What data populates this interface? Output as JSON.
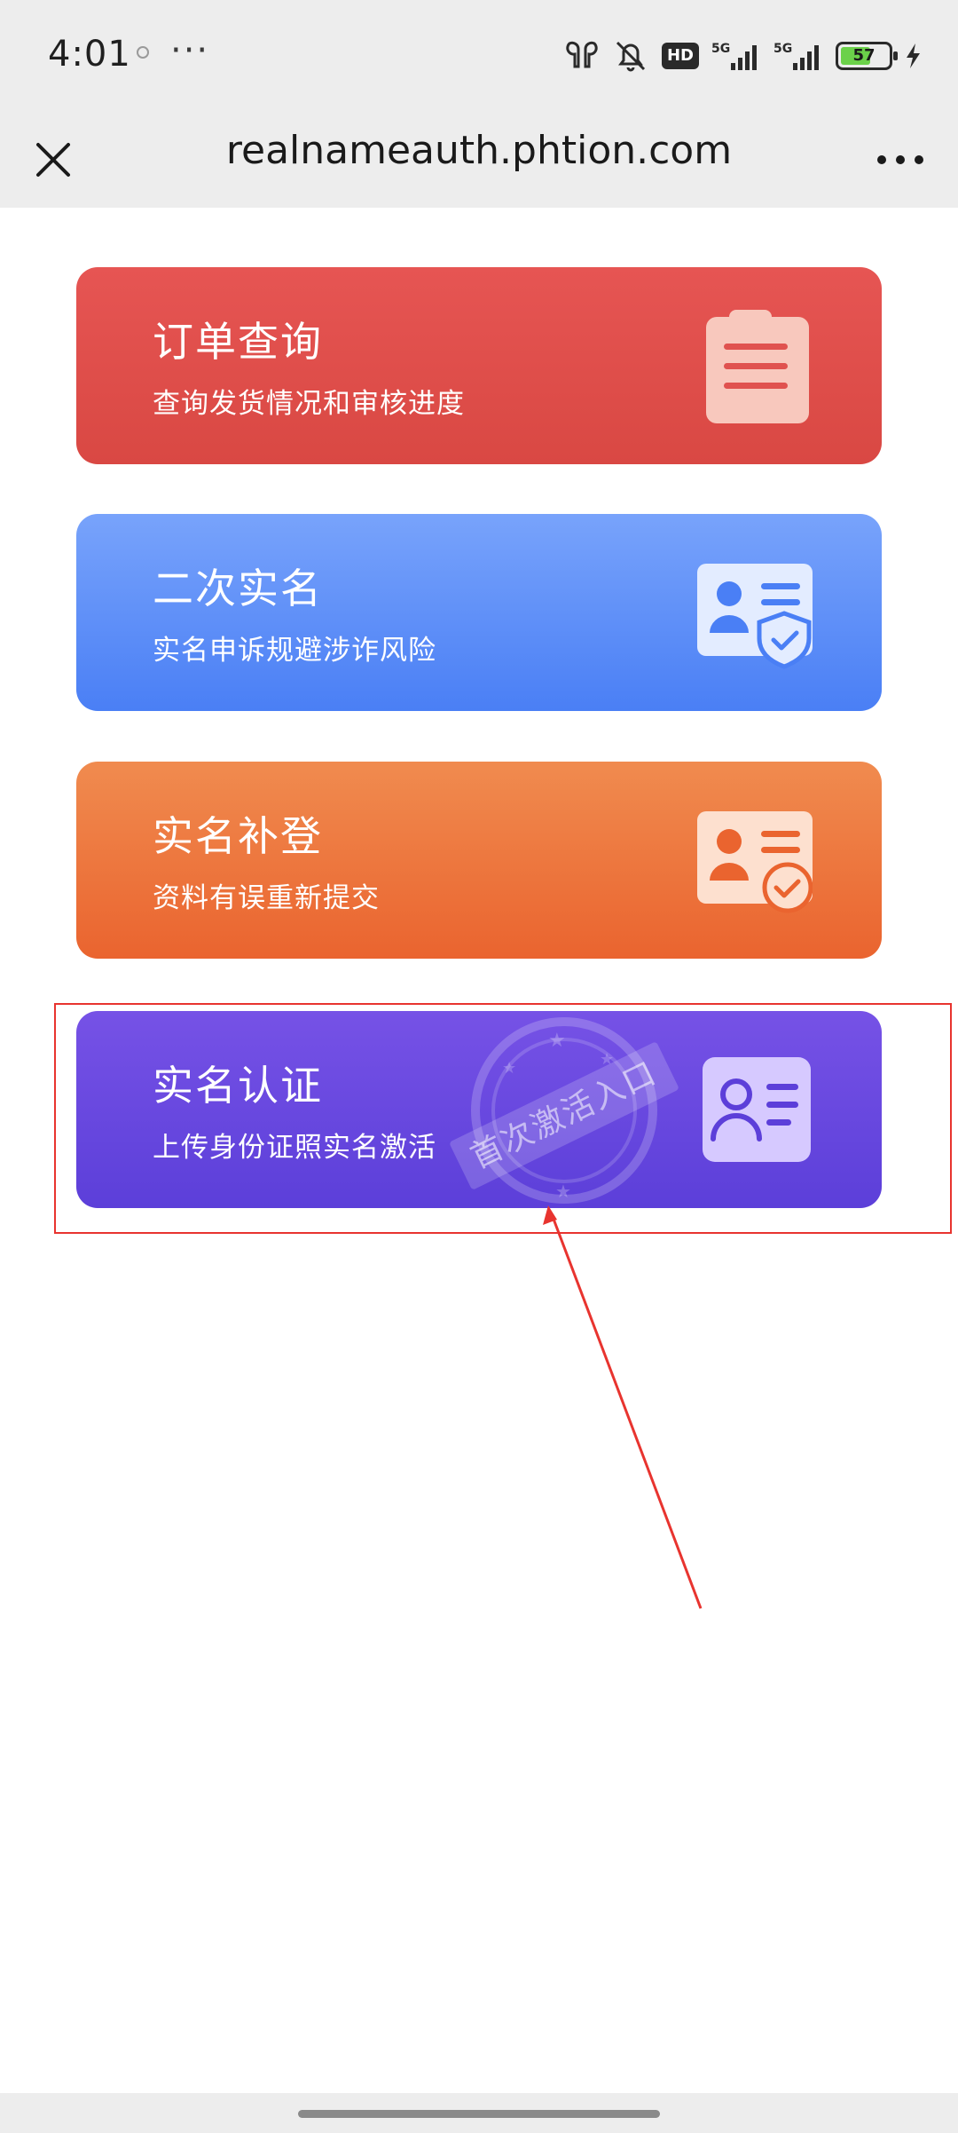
{
  "status_bar": {
    "time": "4:01",
    "more": "···",
    "hd_badge": "HD",
    "signal_1": "5G",
    "signal_2": "5G",
    "battery": "57"
  },
  "nav": {
    "title": "realnameauth.phtion.com",
    "close_icon": "close-icon",
    "more_icon": "more-icon"
  },
  "cards": [
    {
      "title": "订单查询",
      "subtitle": "查询发货情况和审核进度",
      "icon": "clipboard-icon",
      "color": "#e04f4c"
    },
    {
      "title": "二次实名",
      "subtitle": "实名申诉规避涉诈风险",
      "icon": "id-card-shield-icon",
      "color": "#5a8cf7"
    },
    {
      "title": "实名补登",
      "subtitle": "资料有误重新提交",
      "icon": "id-card-check-icon",
      "color": "#ec7540"
    },
    {
      "title": "实名认证",
      "subtitle": "上传身份证照实名激活",
      "icon": "id-card-person-icon",
      "color": "#6747df",
      "stamp": "首次激活入口"
    }
  ],
  "annotation": {
    "box_color": "#e8342f",
    "arrow_color": "#e8342f"
  }
}
